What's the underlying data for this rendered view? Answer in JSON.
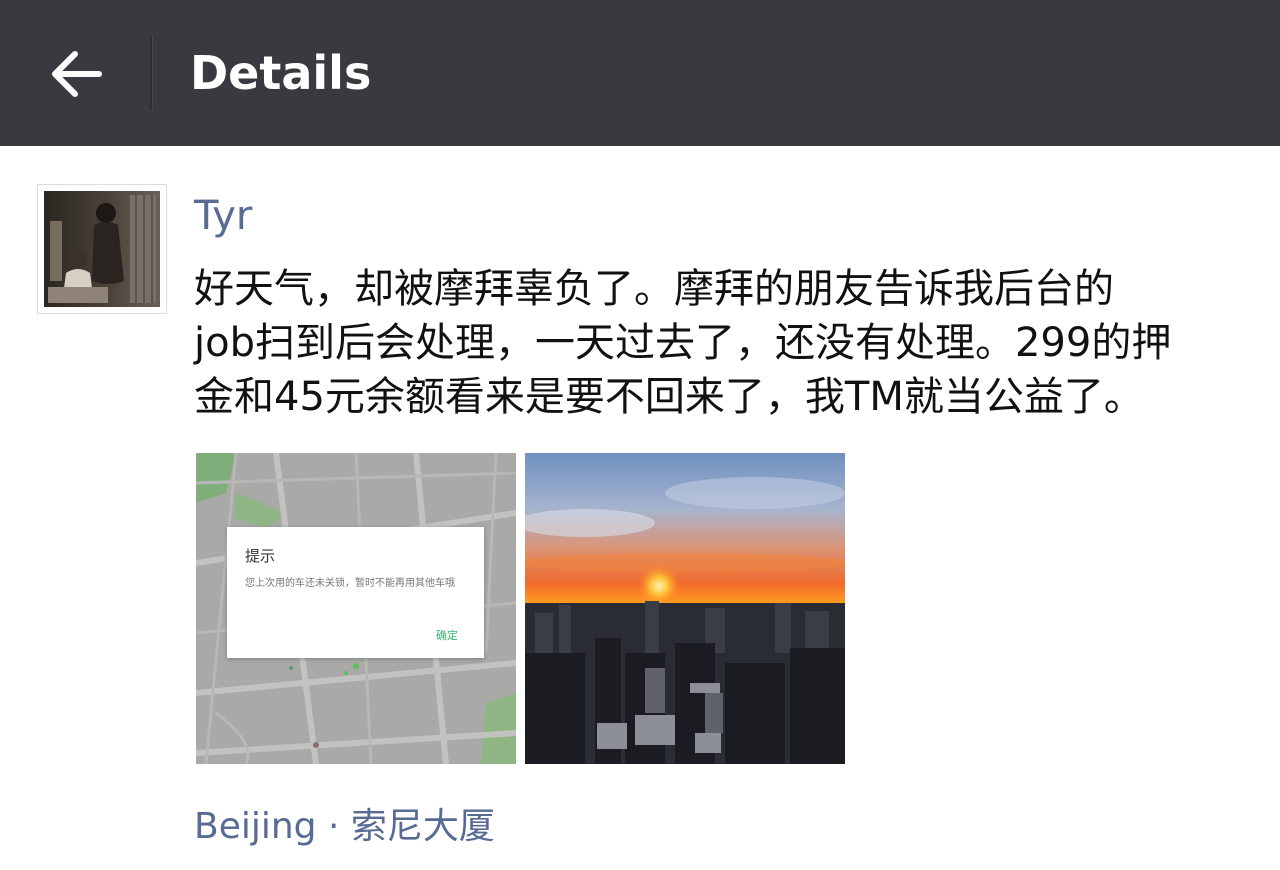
{
  "header": {
    "title": "Details",
    "background": "#393a3f",
    "back_icon": "arrow-left-icon"
  },
  "post": {
    "author": "Tyr",
    "text_lines": [
      "好天气，却被摩拜辜负了。摩拜的朋友告诉我后台的",
      "job扫到后会处理，一天过去了，还没有处理。299的押",
      "金和45元余额看来是要不回来了，我TM就当公益了。"
    ],
    "location": "Beijing · 索尼大厦",
    "link_color": "#576b95",
    "photos": [
      {
        "kind": "map-screenshot",
        "dialog_title": "提示",
        "dialog_message": "您上次用的车还未关锁，暂时不能再用其他车哦",
        "dialog_ok": "确定"
      },
      {
        "kind": "sunset-city"
      }
    ]
  }
}
